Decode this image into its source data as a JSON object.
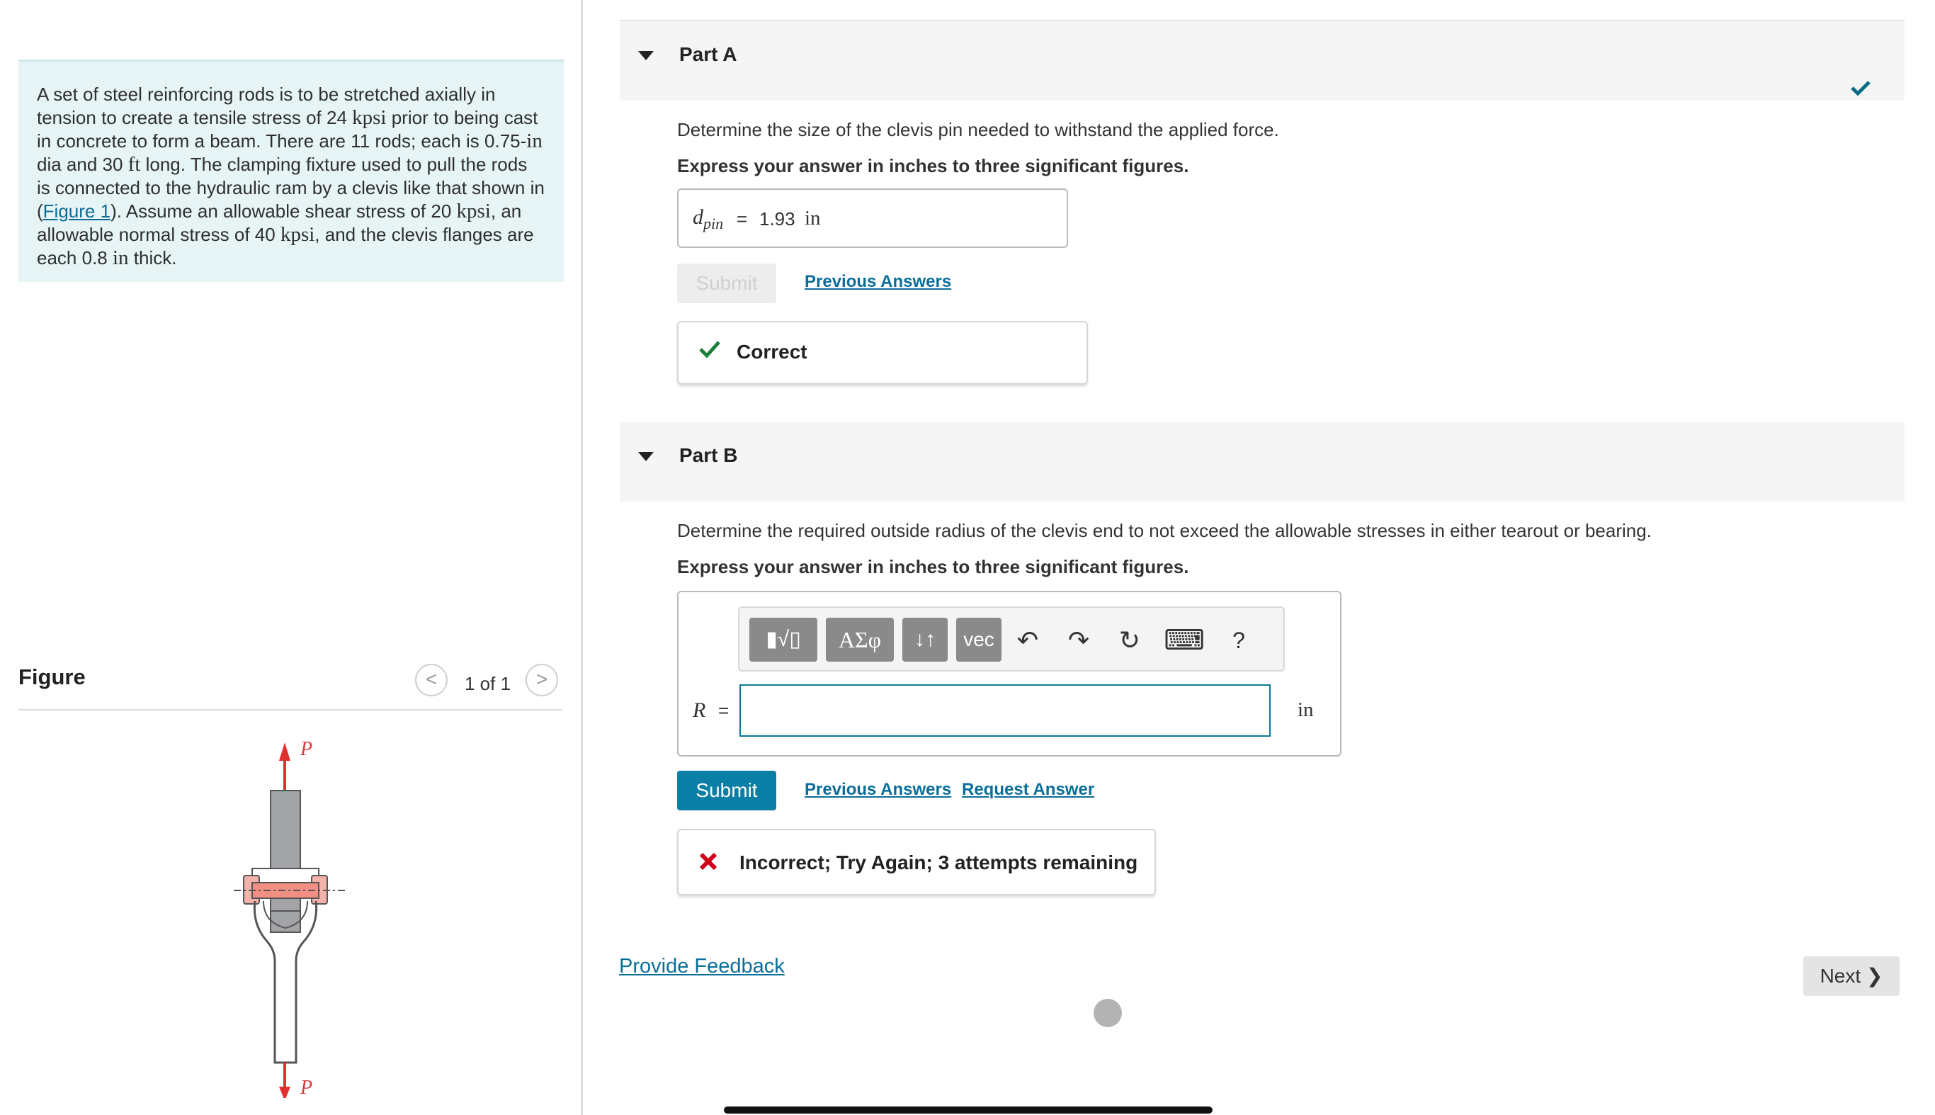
{
  "problem": {
    "segments": [
      {
        "t": "A set of steel reinforcing rods is to be stretched axially in tension to create a tensile stress of 24 "
      },
      {
        "m": "kpsi"
      },
      {
        "t": " prior to being cast in concrete to form a beam. There are 11 rods; each is 0.75-"
      },
      {
        "m": "in"
      },
      {
        "t": " dia and 30 "
      },
      {
        "m": "ft"
      },
      {
        "t": " long. The clamping fixture used to pull the rods is connected to the hydraulic ram by a clevis like that shown in ("
      },
      {
        "link": "Figure 1"
      },
      {
        "t": "). Assume an allowable shear stress of 20 "
      },
      {
        "m": "kpsi"
      },
      {
        "t": ", an allowable normal stress of 40 "
      },
      {
        "m": "kpsi"
      },
      {
        "t": ", and the clevis flanges are each 0.8 "
      },
      {
        "m": "in"
      },
      {
        "t": " thick."
      }
    ]
  },
  "figure": {
    "heading": "Figure",
    "counter": "1 of 1",
    "prev_icon": "<",
    "next_icon": ">",
    "load_label_top": "P",
    "load_label_bottom": "P"
  },
  "partA": {
    "title": "Part A",
    "question": "Determine the size of the clevis pin needed to withstand the applied force.",
    "instruction": "Express your answer in inches to three significant figures.",
    "var": "d",
    "var_sub": "pin",
    "equals": "=",
    "value": "1.93",
    "unit": "in",
    "submit": "Submit",
    "previous_answers": "Previous Answers",
    "feedback": "Correct",
    "status_color": "#1a7f37"
  },
  "partB": {
    "title": "Part B",
    "question": "Determine the required outside radius of the clevis end to not exceed the allowable stresses in either tearout or bearing.",
    "instruction": "Express your answer in inches to three significant figures.",
    "toolbar": {
      "templates": "▮√▯",
      "greek": "ΑΣφ",
      "subsup": "↓↑",
      "vec": "vec",
      "undo": "↶",
      "redo": "↷",
      "reset": "↻",
      "keyboard": "⌨",
      "help": "?"
    },
    "var": "R",
    "equals": "=",
    "input_value": "",
    "unit": "in",
    "submit": "Submit",
    "previous_answers": "Previous Answers",
    "request_answer": "Request Answer",
    "feedback": "Incorrect; Try Again; 3 attempts remaining",
    "error_color": "#d0021b"
  },
  "footer": {
    "provide_feedback": "Provide Feedback",
    "next": "Next"
  }
}
